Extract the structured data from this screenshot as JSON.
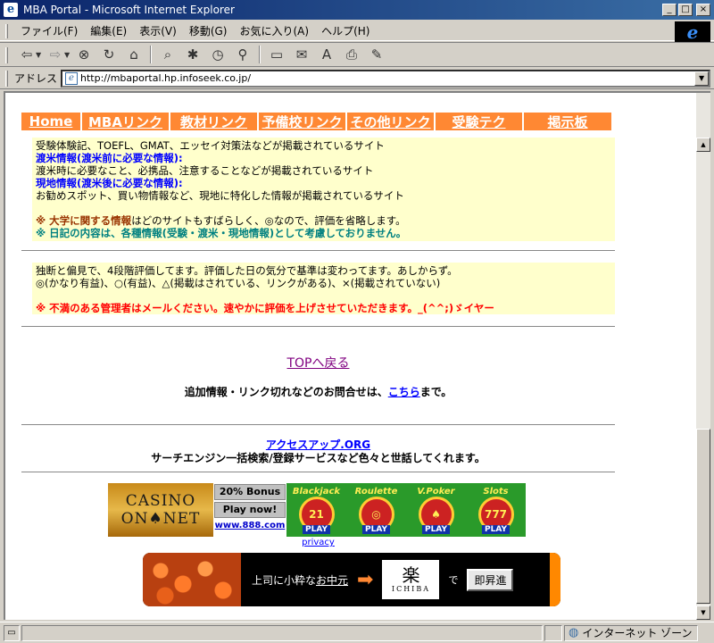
{
  "window": {
    "title": "MBA Portal - Microsoft Internet Explorer",
    "minimize": "_",
    "maximize": "□",
    "close": "×"
  },
  "menu": [
    "ファイル(F)",
    "編集(E)",
    "表示(V)",
    "移動(G)",
    "お気に入り(A)",
    "ヘルプ(H)"
  ],
  "toolbar": {
    "back": "⇦",
    "forward": "⇨",
    "stop": "⊗",
    "refresh": "↻",
    "home": "⌂",
    "search": "⌕",
    "favorites": "✱",
    "history": "◷",
    "channels": "⚲",
    "fullscreen": "▭",
    "mail": "✉",
    "font": "A",
    "print": "⎙",
    "edit": "✎"
  },
  "address": {
    "label": "アドレス",
    "url": "http://mbaportal.hp.infoseek.co.jp/"
  },
  "nav": [
    {
      "label": "Home"
    },
    {
      "label": "MBAリンク"
    },
    {
      "label": "教材リンク"
    },
    {
      "label": "予備校リンク"
    },
    {
      "label": "その他リンク"
    },
    {
      "label": "受験テク"
    },
    {
      "label": "掲示板"
    }
  ],
  "box1": {
    "line1": "受験体験記、TOEFL、GMAT、エッセイ対策法などが掲載されているサイト",
    "heading2": "渡米情報(渡米前に必要な情報):",
    "line3": "渡米時に必要なこと、必携品、注意することなどが掲載されているサイト",
    "heading4": "現地情報(渡米後に必要な情報):",
    "line5": "お勧めスポット、買い物情報など、現地に特化した情報が掲載されているサイト",
    "note1_mark": "※ 大学に関する情報",
    "note1_rest": "はどのサイトもすばらしく、◎なので、評価を省略します。",
    "note2": "※ 日記の内容は、各種情報(受験・渡米・現地情報)として考慮しておりません。"
  },
  "box2": {
    "line1": "独断と偏見で、4段階評価してます。評価した日の気分で基準は変わってます。あしからず。",
    "line2": "◎(かなり有益)、○(有益)、△(掲載はされている、リンクがある)、×(掲載されていない)",
    "line3": "※ 不満のある管理者はメールください。速やかに評価を上げさせていただきます。_(^^;)ゞイヤー"
  },
  "top_link": "TOPへ戻る",
  "contact": {
    "before": "追加情報・リンク切れなどのお問合せは、",
    "link": "こちら",
    "after": "まで。"
  },
  "access": {
    "link": "アクセスアップ.ORG",
    "desc": "サーチエンジン一括検索/登録サービスなど色々と世話してくれます。"
  },
  "casino_banner": {
    "logo_line1": "CASINO",
    "logo_line2": "ON♠NET",
    "bonus": "20% Bonus",
    "play": "Play now!",
    "site": "www.888.com",
    "games": [
      {
        "name": "Blackjack",
        "symbol": "21",
        "play": "PLAY"
      },
      {
        "name": "Roulette",
        "symbol": "◎",
        "play": "PLAY"
      },
      {
        "name": "V.Poker",
        "symbol": "♠",
        "play": "PLAY"
      },
      {
        "name": "Slots",
        "symbol": "777",
        "play": "PLAY"
      }
    ],
    "privacy": "privacy"
  },
  "rakuten_banner": {
    "tag_before": "上司に小粋な",
    "tag_link": "お中元",
    "brand_top": "楽",
    "brand_mid": "天",
    "brand_sub": "ICHIBA",
    "de": "で",
    "button": "即昇進"
  },
  "status": {
    "zone": "インターネット ゾーン"
  }
}
